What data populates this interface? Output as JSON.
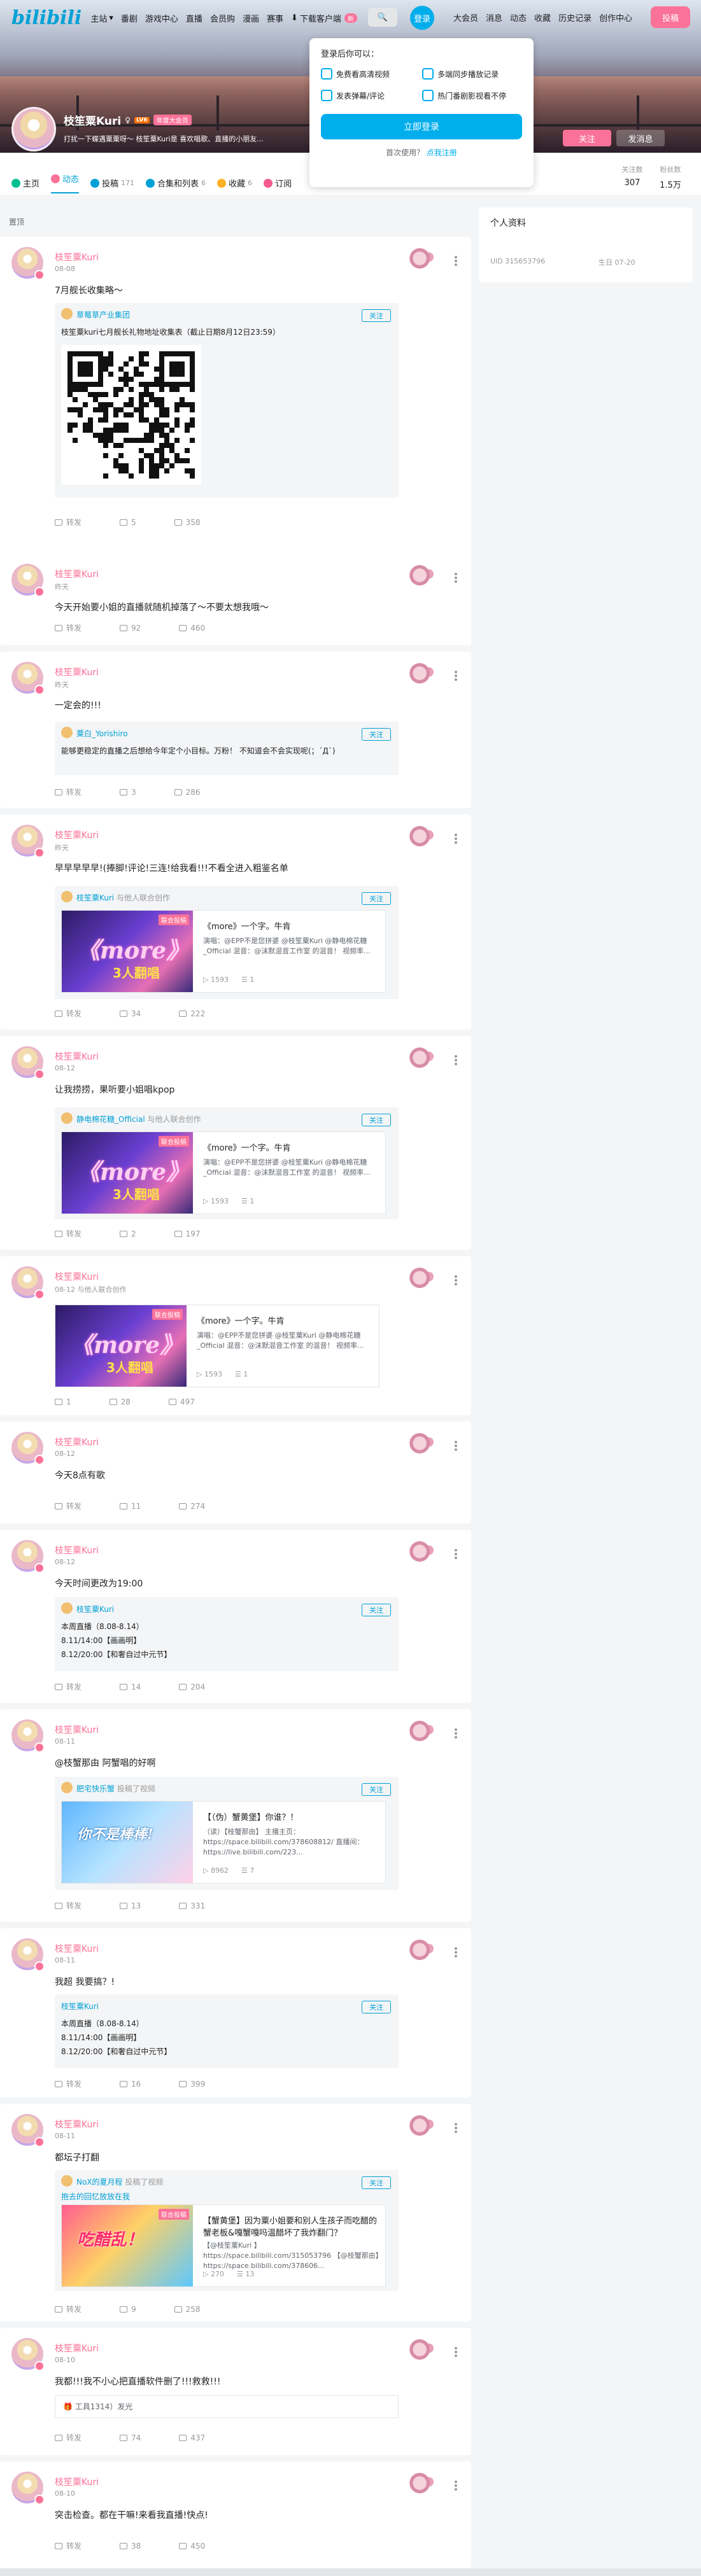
{
  "nav": {
    "logo": "bilibili",
    "left": [
      "主站",
      "番剧",
      "游戏中心",
      "直播",
      "会员购",
      "漫画",
      "赛事"
    ],
    "download": "下载客户端",
    "download_badge": "新",
    "login": "登录",
    "right": [
      "大会员",
      "消息",
      "动态",
      "收藏",
      "历史记录",
      "创作中心"
    ],
    "upload": "投稿"
  },
  "login_popup": {
    "heading": "登录后你可以：",
    "features": [
      "免费看高清视频",
      "多端同步播放记录",
      "发表弹幕/评论",
      "热门番剧影视看不停"
    ],
    "button": "立即登录",
    "register_prefix": "首次使用？",
    "register_link": "点我注册"
  },
  "profile": {
    "name": "枝笙粟Kuri",
    "level": "LV6",
    "badge": "年度大会员",
    "sign": "打扰一下蝶遇粟粟呀～ 枝笙粟Kuri是 喜欢唱歌、直播的小朋友...",
    "follow_button": "关注",
    "message_button": "发消息",
    "tabs": [
      {
        "label": "主页",
        "count": ""
      },
      {
        "label": "动态",
        "count": ""
      },
      {
        "label": "投稿",
        "count": "171"
      },
      {
        "label": "合集和列表",
        "count": "6"
      },
      {
        "label": "收藏",
        "count": "6"
      },
      {
        "label": "订阅",
        "count": ""
      }
    ],
    "stats": [
      {
        "label": "关注数",
        "value": "307"
      },
      {
        "label": "粉丝数",
        "value": "1.5万"
      }
    ]
  },
  "pinned_label": "置顶",
  "sidebar": {
    "title": "个人资料",
    "uid": "UID  315653796",
    "birthday": "生日  07-20"
  },
  "posts": [
    {
      "author": "枝笙粟Kuri",
      "time": "08-08",
      "text": "7月舰长收集略～",
      "share": "转发",
      "comments": "5",
      "likes": "358",
      "repost": {
        "author": "草莓草产业集团",
        "follow": "关注",
        "text": "枝笙粟kuri七月舰长礼物地址收集表（截止日期8月12日23:59）"
      }
    },
    {
      "author": "枝笙粟Kuri",
      "time": "昨天",
      "text": "今天开始要小姐的直播就随机掉落了～不要太想我哦～",
      "share": "转发",
      "comments": "92",
      "likes": "460"
    },
    {
      "author": "枝笙粟Kuri",
      "time": "昨天",
      "text": "一定会的!!!",
      "share": "转发",
      "comments": "3",
      "likes": "286",
      "repost": {
        "author": "粟白_Yorishiro",
        "follow": "关注",
        "text": "能够更稳定的直播之后想给今年定个小目标。万粉！ 不知道会不会实现呢(；´Д`)"
      }
    },
    {
      "author": "枝笙粟Kuri",
      "time": "昨天",
      "text": "早早早早早!(捧脚!评论!三连!给我看!!!不看全进入粗鉴名单",
      "share": "转发",
      "comments": "34",
      "likes": "222",
      "repost": {
        "author": "枝笙粟Kuri",
        "sub": "与他人联合创作",
        "follow": "关注",
        "video": {
          "cover": "《more》",
          "cover_tag": "3人翻唱",
          "cover_badge": "联合投稿",
          "title": "《more》一个字。牛肯",
          "desc": "演唱：@EPP不是您拼婆 @枝笙粟Kuri @静电棉花糖_Official 混音：@沫默混音工作室 的混音！ 视频率...",
          "plays": "1593",
          "danmaku": "1"
        }
      }
    },
    {
      "author": "枝笙粟Kuri",
      "time": "08-12",
      "text": "让我捞捞，果听要小姐唱kpop",
      "share": "转发",
      "comments": "2",
      "likes": "197",
      "repost": {
        "author": "静电棉花糖_Official",
        "sub": "与他人联合创作",
        "follow": "关注",
        "video": {
          "cover": "《more》",
          "cover_tag": "3人翻唱",
          "cover_badge": "联合投稿",
          "title": "《more》一个字。牛肯",
          "desc": "演唱：@EPP不是您拼婆 @枝笙粟Kuri @静电棉花糖_Official 混音：@沫默混音工作室 的混音！ 视频率...",
          "plays": "1593",
          "danmaku": "1"
        }
      }
    },
    {
      "author": "枝笙粟Kuri",
      "time": "08-12",
      "sub": "与他人联合创作",
      "text": "",
      "share": "1",
      "comments": "28",
      "likes": "497",
      "video": {
        "cover": "《more》",
        "cover_tag": "3人翻唱",
        "cover_badge": "联合投稿",
        "title": "《more》一个字。牛肯",
        "desc": "演唱：@EPP不是您拼婆 @枝笙粟Kuri @静电棉花糖_Official 混音：@沫默混音工作室 的混音！ 视频率...",
        "plays": "1593",
        "danmaku": "1"
      }
    },
    {
      "author": "枝笙粟Kuri",
      "time": "08-12",
      "text": "今天8点有歌",
      "share": "转发",
      "comments": "11",
      "likes": "274"
    },
    {
      "author": "枝笙粟Kuri",
      "time": "08-12",
      "text": "今天时间更改为19:00",
      "share": "转发",
      "comments": "14",
      "likes": "204",
      "repost": {
        "author": "枝笙粟Kuri",
        "follow": "关注",
        "lines": [
          "本周直播（8.08-8.14）",
          "8.11/14:00【画画明】",
          "8.12/20:00【和奢自过中元节】"
        ]
      }
    },
    {
      "author": "枝笙粟Kuri",
      "time": "08-11",
      "text": "@枝蟹那由 阿蟹唱的好啊",
      "share": "转发",
      "comments": "13",
      "likes": "331",
      "repost": {
        "author": "肥宅快乐蟹",
        "sub": "投稿了视频",
        "follow": "关注",
        "video": {
          "cover": "你不是棒棒!",
          "cover_tag": "",
          "cover_badge": "",
          "title": "【（伪）蟹黄堡】你谁？！",
          "desc": "（读）【枝蟹那由】 主播主页：https://space.bilibili.com/378608812/ 直播间：https://live.bilibili.com/223...",
          "plays": "8962",
          "danmaku": "7"
        }
      }
    },
    {
      "author": "枝笙粟Kuri",
      "time": "08-11",
      "text": "我超 我要搞？!",
      "share": "转发",
      "comments": "16",
      "likes": "399",
      "repost": {
        "author": "枝笙粟Kuri",
        "follow": "关注",
        "lines": [
          "本周直播（8.08-8.14）",
          "8.11/14:00【画画明】",
          "8.12/20:00【和奢自过中元节】"
        ]
      }
    },
    {
      "author": "枝笙粟Kuri",
      "time": "08-11",
      "text": "都坛子打翻",
      "share": "转发",
      "comments": "9",
      "likes": "258",
      "repost": {
        "author": "NoX的夏月程",
        "sub": "投稿了视频",
        "follow": "关注",
        "tag": "抱去的回忆放放在我",
        "video": {
          "cover": "吃醋乱！",
          "cover_tag": "",
          "cover_badge": "联合投稿",
          "title": "【蟹黄堡】因为粟小姐要和别人生孩子而吃醋的蟹老板&嘎蟹嘎吗温醋坏了我炸翻门？",
          "desc": "【@枝笙粟Kuri 】https://space.bilibili.com/315053796 【@枝蟹那由】https://space.bilibili.com/378606...",
          "plays": "270",
          "danmaku": "13"
        }
      }
    },
    {
      "author": "枝笙粟Kuri",
      "time": "08-10",
      "text": "我都!!!我不小心把直播软件删了!!!救救!!!",
      "share": "转发",
      "comments": "74",
      "likes": "437",
      "note": "工具1314）发光"
    },
    {
      "author": "枝笙粟Kuri",
      "time": "08-10",
      "text": "突击检查。都在干嘛!来看我直播!快点!",
      "share": "转发",
      "comments": "38",
      "likes": "450"
    }
  ]
}
